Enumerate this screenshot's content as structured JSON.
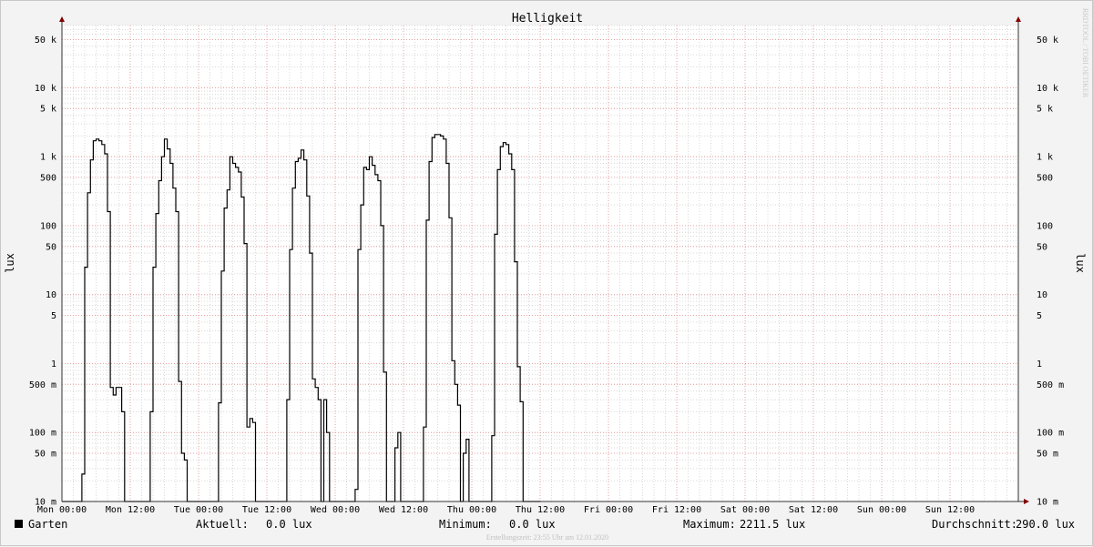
{
  "chart_data": {
    "type": "line",
    "title": "Helligkeit",
    "ylabel": "lux",
    "y_scale": "log",
    "ylim": [
      0.01,
      80000
    ],
    "xlim": [
      0,
      168
    ],
    "x_unit": "hours since Mon 00:00",
    "y_ticks": [
      {
        "value": 50000,
        "label": "50 k"
      },
      {
        "value": 10000,
        "label": "10 k"
      },
      {
        "value": 5000,
        "label": "5 k"
      },
      {
        "value": 1000,
        "label": "1 k"
      },
      {
        "value": 500,
        "label": "500"
      },
      {
        "value": 100,
        "label": "100"
      },
      {
        "value": 50,
        "label": "50"
      },
      {
        "value": 10,
        "label": "10"
      },
      {
        "value": 5,
        "label": "5"
      },
      {
        "value": 1,
        "label": "1"
      },
      {
        "value": 0.5,
        "label": "500 m"
      },
      {
        "value": 0.1,
        "label": "100 m"
      },
      {
        "value": 0.05,
        "label": "50 m"
      },
      {
        "value": 0.01,
        "label": "10 m"
      }
    ],
    "x_ticks": [
      {
        "value": 0,
        "label": "Mon 00:00"
      },
      {
        "value": 12,
        "label": "Mon 12:00"
      },
      {
        "value": 24,
        "label": "Tue 00:00"
      },
      {
        "value": 36,
        "label": "Tue 12:00"
      },
      {
        "value": 48,
        "label": "Wed 00:00"
      },
      {
        "value": 60,
        "label": "Wed 12:00"
      },
      {
        "value": 72,
        "label": "Thu 00:00"
      },
      {
        "value": 84,
        "label": "Thu 12:00"
      },
      {
        "value": 96,
        "label": "Fri 00:00"
      },
      {
        "value": 108,
        "label": "Fri 12:00"
      },
      {
        "value": 120,
        "label": "Sat 00:00"
      },
      {
        "value": 132,
        "label": "Sat 12:00"
      },
      {
        "value": 144,
        "label": "Sun 00:00"
      },
      {
        "value": 156,
        "label": "Sun 12:00"
      }
    ],
    "grid": true,
    "series": [
      {
        "name": "Garten",
        "color": "#000000",
        "points": [
          [
            0,
            0.01
          ],
          [
            3.5,
            0.01
          ],
          [
            3.5,
            0.025
          ],
          [
            4,
            0.025
          ],
          [
            4,
            25
          ],
          [
            4.5,
            25
          ],
          [
            4.5,
            300
          ],
          [
            5,
            300
          ],
          [
            5,
            900
          ],
          [
            5.5,
            900
          ],
          [
            5.5,
            1700
          ],
          [
            6,
            1700
          ],
          [
            6,
            1800
          ],
          [
            6.5,
            1800
          ],
          [
            6.5,
            1700
          ],
          [
            7,
            1700
          ],
          [
            7,
            1500
          ],
          [
            7.5,
            1500
          ],
          [
            7.5,
            1100
          ],
          [
            8,
            1100
          ],
          [
            8,
            160
          ],
          [
            8.5,
            160
          ],
          [
            8.5,
            0.45
          ],
          [
            9,
            0.45
          ],
          [
            9,
            0.35
          ],
          [
            9.5,
            0.35
          ],
          [
            9.5,
            0.45
          ],
          [
            10.5,
            0.45
          ],
          [
            10.5,
            0.2
          ],
          [
            11,
            0.2
          ],
          [
            11,
            0.01
          ],
          [
            15.5,
            0.01
          ],
          [
            15.5,
            0.2
          ],
          [
            16,
            0.2
          ],
          [
            16,
            25
          ],
          [
            16.5,
            25
          ],
          [
            16.5,
            150
          ],
          [
            17,
            150
          ],
          [
            17,
            450
          ],
          [
            17.5,
            450
          ],
          [
            17.5,
            1000
          ],
          [
            18,
            1000
          ],
          [
            18,
            1800
          ],
          [
            18.5,
            1800
          ],
          [
            18.5,
            1300
          ],
          [
            19,
            1300
          ],
          [
            19,
            800
          ],
          [
            19.5,
            800
          ],
          [
            19.5,
            350
          ],
          [
            20,
            350
          ],
          [
            20,
            160
          ],
          [
            20.5,
            160
          ],
          [
            20.5,
            0.55
          ],
          [
            21,
            0.55
          ],
          [
            21,
            0.05
          ],
          [
            21.5,
            0.05
          ],
          [
            21.5,
            0.04
          ],
          [
            22,
            0.04
          ],
          [
            22,
            0.01
          ],
          [
            27.5,
            0.01
          ],
          [
            27.5,
            0.27
          ],
          [
            28,
            0.27
          ],
          [
            28,
            22
          ],
          [
            28.5,
            22
          ],
          [
            28.5,
            180
          ],
          [
            29,
            180
          ],
          [
            29,
            330
          ],
          [
            29.5,
            330
          ],
          [
            29.5,
            1000
          ],
          [
            30,
            1000
          ],
          [
            30,
            800
          ],
          [
            30.5,
            800
          ],
          [
            30.5,
            700
          ],
          [
            31,
            700
          ],
          [
            31,
            600
          ],
          [
            31.5,
            600
          ],
          [
            31.5,
            260
          ],
          [
            32,
            260
          ],
          [
            32,
            55
          ],
          [
            32.5,
            55
          ],
          [
            32.5,
            0.12
          ],
          [
            33,
            0.12
          ],
          [
            33,
            0.16
          ],
          [
            33.5,
            0.16
          ],
          [
            33.5,
            0.14
          ],
          [
            34,
            0.14
          ],
          [
            34,
            0.01
          ],
          [
            39.5,
            0.01
          ],
          [
            39.5,
            0.3
          ],
          [
            40,
            0.3
          ],
          [
            40,
            45
          ],
          [
            40.5,
            45
          ],
          [
            40.5,
            350
          ],
          [
            41,
            350
          ],
          [
            41,
            850
          ],
          [
            41.5,
            850
          ],
          [
            41.5,
            950
          ],
          [
            42,
            950
          ],
          [
            42,
            1250
          ],
          [
            42.5,
            1250
          ],
          [
            42.5,
            900
          ],
          [
            43,
            900
          ],
          [
            43,
            270
          ],
          [
            43.5,
            270
          ],
          [
            43.5,
            40
          ],
          [
            44,
            40
          ],
          [
            44,
            0.6
          ],
          [
            44.5,
            0.6
          ],
          [
            44.5,
            0.45
          ],
          [
            45,
            0.45
          ],
          [
            45,
            0.3
          ],
          [
            45.5,
            0.3
          ],
          [
            45.5,
            0.01
          ],
          [
            46,
            0.01
          ],
          [
            46,
            0.3
          ],
          [
            46.5,
            0.3
          ],
          [
            46.5,
            0.1
          ],
          [
            47,
            0.1
          ],
          [
            47,
            0.01
          ],
          [
            51.5,
            0.01
          ],
          [
            51.5,
            0.015
          ],
          [
            52,
            0.015
          ],
          [
            52,
            45
          ],
          [
            52.5,
            45
          ],
          [
            52.5,
            200
          ],
          [
            53,
            200
          ],
          [
            53,
            700
          ],
          [
            53.5,
            700
          ],
          [
            53.5,
            650
          ],
          [
            54,
            650
          ],
          [
            54,
            1000
          ],
          [
            54.5,
            1000
          ],
          [
            54.5,
            750
          ],
          [
            55,
            750
          ],
          [
            55,
            550
          ],
          [
            55.5,
            550
          ],
          [
            55.5,
            450
          ],
          [
            56,
            450
          ],
          [
            56,
            100
          ],
          [
            56.5,
            100
          ],
          [
            56.5,
            0.75
          ],
          [
            57,
            0.75
          ],
          [
            57,
            0.01
          ],
          [
            58.5,
            0.01
          ],
          [
            58.5,
            0.06
          ],
          [
            59,
            0.06
          ],
          [
            59,
            0.1
          ],
          [
            59.5,
            0.1
          ],
          [
            59.5,
            0.01
          ],
          [
            63.5,
            0.01
          ],
          [
            63.5,
            0.12
          ],
          [
            64,
            0.12
          ],
          [
            64,
            120
          ],
          [
            64.5,
            120
          ],
          [
            64.5,
            850
          ],
          [
            65,
            850
          ],
          [
            65,
            1900
          ],
          [
            65.5,
            1900
          ],
          [
            65.5,
            2100
          ],
          [
            66.5,
            2100
          ],
          [
            66.5,
            2000
          ],
          [
            67,
            2000
          ],
          [
            67,
            1800
          ],
          [
            67.5,
            1800
          ],
          [
            67.5,
            800
          ],
          [
            68,
            800
          ],
          [
            68,
            130
          ],
          [
            68.5,
            130
          ],
          [
            68.5,
            1.1
          ],
          [
            69,
            1.1
          ],
          [
            69,
            0.5
          ],
          [
            69.5,
            0.5
          ],
          [
            69.5,
            0.25
          ],
          [
            70,
            0.25
          ],
          [
            70,
            0.01
          ],
          [
            70.5,
            0.01
          ],
          [
            70.5,
            0.05
          ],
          [
            71,
            0.05
          ],
          [
            71,
            0.08
          ],
          [
            71.5,
            0.08
          ],
          [
            71.5,
            0.01
          ],
          [
            75.5,
            0.01
          ],
          [
            75.5,
            0.09
          ],
          [
            76,
            0.09
          ],
          [
            76,
            75
          ],
          [
            76.5,
            75
          ],
          [
            76.5,
            650
          ],
          [
            77,
            650
          ],
          [
            77,
            1400
          ],
          [
            77.5,
            1400
          ],
          [
            77.5,
            1600
          ],
          [
            78,
            1600
          ],
          [
            78,
            1500
          ],
          [
            78.5,
            1500
          ],
          [
            78.5,
            1100
          ],
          [
            79,
            1100
          ],
          [
            79,
            650
          ],
          [
            79.5,
            650
          ],
          [
            79.5,
            30
          ],
          [
            80,
            30
          ],
          [
            80,
            0.9
          ],
          [
            80.5,
            0.9
          ],
          [
            80.5,
            0.28
          ],
          [
            81,
            0.28
          ],
          [
            81,
            0.01
          ],
          [
            84,
            0.01
          ]
        ]
      }
    ]
  },
  "legend": {
    "series_name": "Garten",
    "aktuell_label": "Aktuell:",
    "aktuell_value": "0.0 lux",
    "minimum_label": "Minimum:",
    "minimum_value": "0.0 lux",
    "maximum_label": "Maximum:",
    "maximum_value": "2211.5 lux",
    "avg_label": "Durchschnitt:",
    "avg_value": "290.0 lux"
  },
  "footer": "Erstellungszeit: 23:55 Uhr am 12.01.2020",
  "watermark": "RRDTOOL / TOBI OETIKER",
  "colors": {
    "background": "#f3f3f3",
    "plot_bg": "#ffffff",
    "major_grid": "#e8a0a0",
    "minor_grid": "#d8d8d8",
    "axis_arrow": "#800000"
  }
}
